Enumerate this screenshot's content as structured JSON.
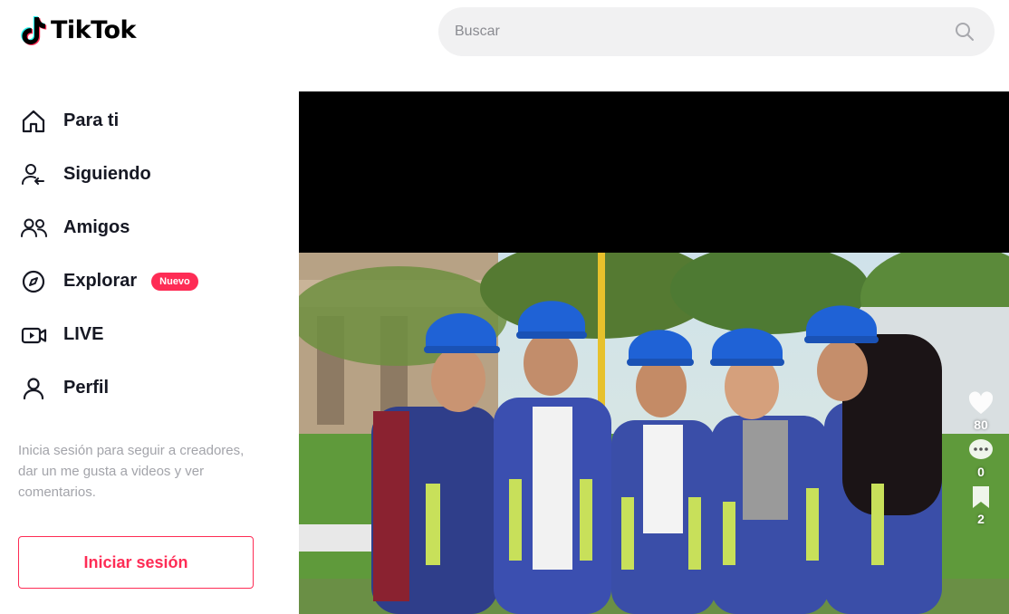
{
  "brand": {
    "name": "TikTok",
    "accent": "#fe2c55"
  },
  "search": {
    "placeholder": "Buscar",
    "value": ""
  },
  "sidebar": {
    "items": [
      {
        "label": "Para ti",
        "icon": "home-icon"
      },
      {
        "label": "Siguiendo",
        "icon": "following-icon"
      },
      {
        "label": "Amigos",
        "icon": "friends-icon"
      },
      {
        "label": "Explorar",
        "icon": "compass-icon",
        "badge": "Nuevo"
      },
      {
        "label": "LIVE",
        "icon": "live-icon"
      },
      {
        "label": "Perfil",
        "icon": "profile-icon"
      }
    ],
    "login_hint": "Inicia sesión para seguir a creadores, dar un me gusta a videos y ver comentarios.",
    "login_button": "Iniciar sesión"
  },
  "video": {
    "actions": {
      "likes": "80",
      "comments": "0",
      "bookmarks": "2"
    }
  }
}
